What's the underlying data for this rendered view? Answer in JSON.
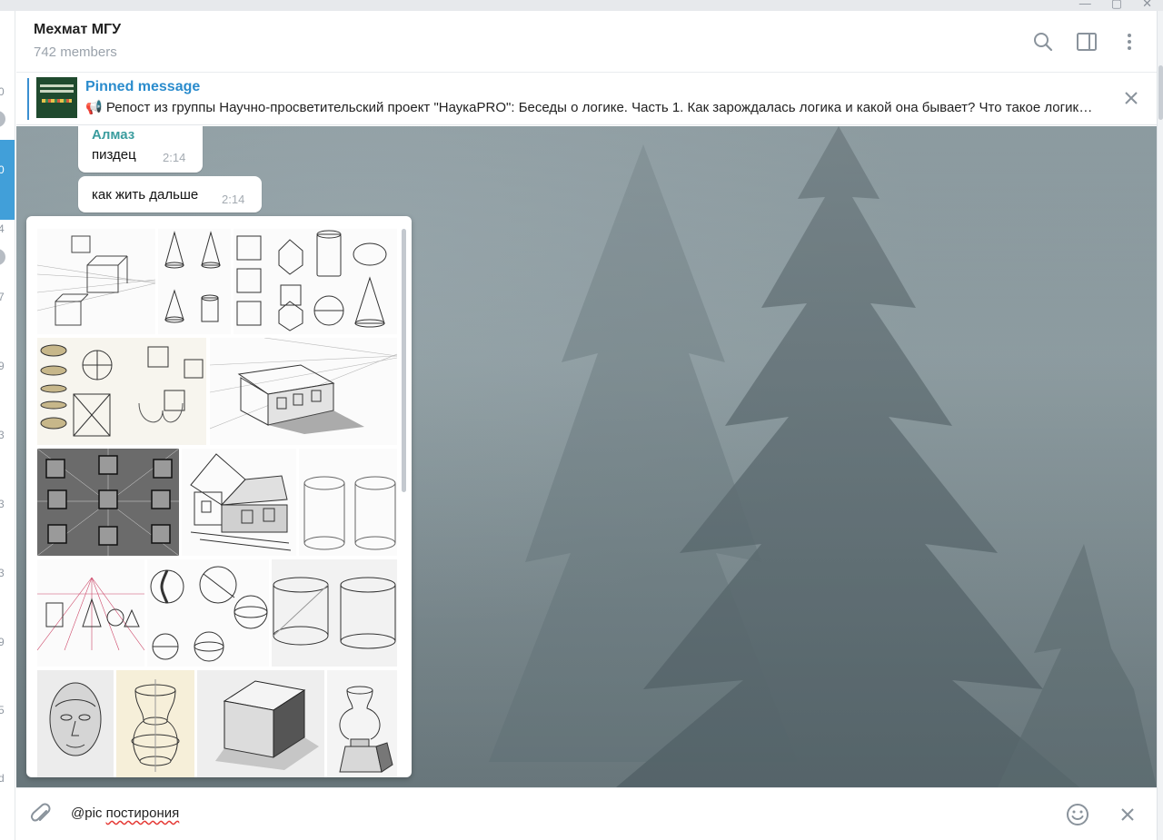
{
  "header": {
    "title": "Мехмат МГУ",
    "subtitle": "742 members"
  },
  "sidebar": {
    "numbers": [
      "0",
      "0",
      "4",
      "7",
      "9",
      "3",
      "3",
      "3",
      "9",
      "5",
      "d"
    ]
  },
  "pinned": {
    "label": "Pinned message",
    "text": "📢 Репост из группы Научно-просветительский проект \"НаукаPRO\": Беседы о логике. Часть 1. Как зарождалась логика и какой она бывает? Что такое логика?"
  },
  "messages": [
    {
      "author": "Алмаз",
      "text": "пиздец",
      "time": "2:14"
    },
    {
      "author": "",
      "text": "как жить дальше",
      "time": "2:14"
    }
  ],
  "composer": {
    "prefix": "@pic ",
    "query": "постирония"
  },
  "icons": {
    "header": [
      "search-icon",
      "sidebar-toggle-icon",
      "more-vertical-icon"
    ],
    "pinned": [
      "close-icon"
    ],
    "composer": [
      "attach-icon",
      "emoji-icon",
      "close-icon"
    ]
  },
  "colors": {
    "accent": "#2b8ccd",
    "author": "#3a9c9e",
    "active_chat": "#419fd9"
  }
}
